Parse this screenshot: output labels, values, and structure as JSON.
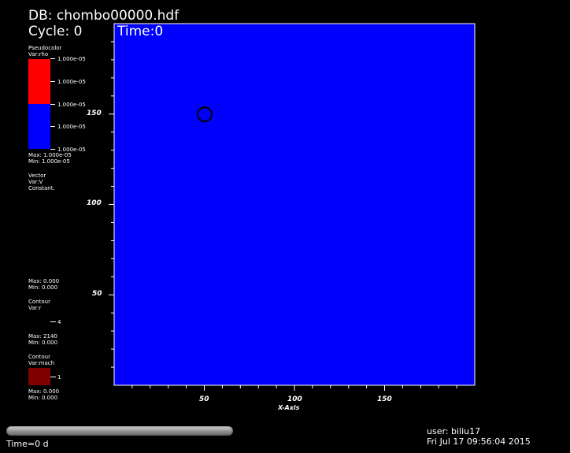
{
  "header": {
    "db_label": "DB: chombo00000.hdf",
    "cycle_label": "Cycle: 0",
    "time_label": "Time:0"
  },
  "legend": {
    "pseudocolor": {
      "title": "Pseudocolor",
      "var": "Var:rho",
      "levels": [
        "1.000e-05",
        "1.000e-05",
        "1.000e-05",
        "1.000e-05",
        "1.000e-05"
      ],
      "max": "Max: 1.000e-05",
      "min": "Min: 1.000e-05",
      "colors": [
        "#ff0000",
        "#0000ff"
      ]
    },
    "vector": {
      "title": "Vector",
      "var": "Var:V",
      "mode": "Constant.",
      "max": "Max: 0.000",
      "min": "Min: 0.000"
    },
    "contour_r": {
      "title": "Contour",
      "var": "Var:r",
      "level": "4",
      "max": "Max: 2140",
      "min": "Min: 0.000"
    },
    "contour_mach": {
      "title": "Contour",
      "var": "Var:mach",
      "level": "1",
      "max": "Max: 0.000",
      "min": "Min: 0.000",
      "color": "#800000"
    }
  },
  "plot": {
    "background": "#0000ff",
    "border_color": "#ffffff",
    "xlabel": "X-Axis",
    "x_ticks": [
      "50",
      "100",
      "150"
    ],
    "y_ticks": [
      "150",
      "100",
      "50"
    ],
    "marker": {
      "x": 50,
      "y": 150,
      "shape": "circle-outline"
    }
  },
  "chart_data": {
    "type": "heatmap",
    "title": "",
    "xlabel": "X-Axis",
    "ylabel": "",
    "xlim": [
      0,
      200
    ],
    "ylim": [
      0,
      200
    ],
    "x_ticks": [
      50,
      100,
      150
    ],
    "y_ticks": [
      50,
      100,
      150
    ],
    "field_value": 1e-05,
    "marker_point": {
      "x": 50,
      "y": 150
    }
  },
  "footer": {
    "time_text": "Time=0 d",
    "user_text": "user: biliu17",
    "date_text": "Fri Jul 17 09:56:04 2015"
  }
}
